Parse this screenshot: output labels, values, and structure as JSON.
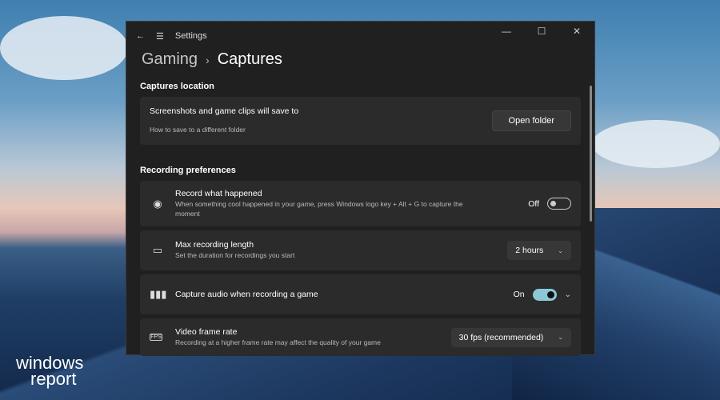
{
  "window": {
    "title": "Settings",
    "breadcrumb_parent": "Gaming",
    "breadcrumb_current": "Captures"
  },
  "captures_location": {
    "heading": "Captures location",
    "title": "Screenshots and game clips will save to",
    "link": "How to save to a different folder",
    "button": "Open folder"
  },
  "recording": {
    "heading": "Recording preferences",
    "items": [
      {
        "title": "Record what happened",
        "desc": "When something cool happened in your game, press Windows logo key + Alt + G to capture the moment",
        "state": "Off",
        "icon": "record-icon"
      },
      {
        "title": "Max recording length",
        "desc": "Set the duration for recordings you start",
        "value": "2 hours",
        "icon": "camera-icon"
      },
      {
        "title": "Capture audio when recording a game",
        "state": "On",
        "icon": "audio-icon"
      },
      {
        "title": "Video frame rate",
        "desc": "Recording at a higher frame rate may affect the quality of your game",
        "value": "30 fps (recommended)",
        "icon": "fps-icon"
      }
    ]
  },
  "watermark": {
    "line1": "windows",
    "line2": "report"
  },
  "colors": {
    "toggle_on": "#8cc8d8",
    "window_bg": "#202020",
    "card_bg": "#2b2b2b"
  }
}
